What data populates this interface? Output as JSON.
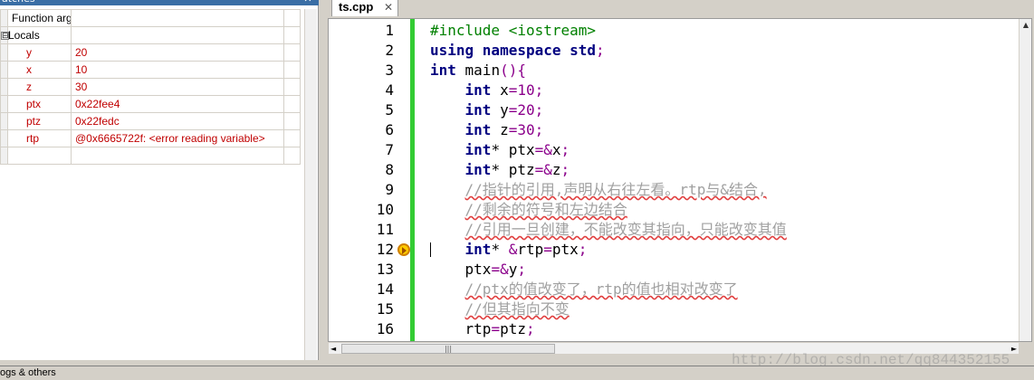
{
  "watches": {
    "title": "atches",
    "close": "✕",
    "rows": [
      {
        "name": "Function arg",
        "value": "",
        "type": "",
        "color": "#000000",
        "expander": ""
      },
      {
        "name": "Locals",
        "value": "",
        "type": "",
        "color": "#000000",
        "expander": "⊟"
      },
      {
        "name": "y",
        "value": "20",
        "type": "",
        "color": "#c00000",
        "expander": ""
      },
      {
        "name": "x",
        "value": "10",
        "type": "",
        "color": "#c00000",
        "expander": ""
      },
      {
        "name": "z",
        "value": "30",
        "type": "",
        "color": "#c00000",
        "expander": ""
      },
      {
        "name": "ptx",
        "value": "0x22fee4",
        "type": "",
        "color": "#c00000",
        "expander": ""
      },
      {
        "name": "ptz",
        "value": "0x22fedc",
        "type": "",
        "color": "#c00000",
        "expander": ""
      },
      {
        "name": "rtp",
        "value": "@0x6665722f: <error reading variable>",
        "type": "",
        "color": "#c00000",
        "expander": ""
      },
      {
        "name": "",
        "value": "",
        "type": "",
        "color": "#000000",
        "expander": ""
      }
    ]
  },
  "editor": {
    "tab_label": "ts.cpp",
    "tab_close": "✕",
    "breakpoint_line": 12,
    "lines": [
      {
        "num": "1",
        "tokens": [
          {
            "t": "#include <iostream>",
            "c": "pp"
          }
        ]
      },
      {
        "num": "2",
        "tokens": [
          {
            "t": "using namespace std",
            "c": "kw"
          },
          {
            "t": ";",
            "c": "op"
          }
        ]
      },
      {
        "num": "3",
        "tokens": [
          {
            "t": "int",
            "c": "kw"
          },
          {
            "t": " main",
            "c": "id"
          },
          {
            "t": "(){",
            "c": "op"
          }
        ]
      },
      {
        "num": "4",
        "tokens": [
          {
            "t": "    ",
            "c": "id"
          },
          {
            "t": "int",
            "c": "kw"
          },
          {
            "t": " x",
            "c": "id"
          },
          {
            "t": "=",
            "c": "op"
          },
          {
            "t": "10",
            "c": "nm"
          },
          {
            "t": ";",
            "c": "op"
          }
        ]
      },
      {
        "num": "5",
        "tokens": [
          {
            "t": "    ",
            "c": "id"
          },
          {
            "t": "int",
            "c": "kw"
          },
          {
            "t": " y",
            "c": "id"
          },
          {
            "t": "=",
            "c": "op"
          },
          {
            "t": "20",
            "c": "nm"
          },
          {
            "t": ";",
            "c": "op"
          }
        ]
      },
      {
        "num": "6",
        "tokens": [
          {
            "t": "    ",
            "c": "id"
          },
          {
            "t": "int",
            "c": "kw"
          },
          {
            "t": " z",
            "c": "id"
          },
          {
            "t": "=",
            "c": "op"
          },
          {
            "t": "30",
            "c": "nm"
          },
          {
            "t": ";",
            "c": "op"
          }
        ]
      },
      {
        "num": "7",
        "tokens": [
          {
            "t": "    ",
            "c": "id"
          },
          {
            "t": "int",
            "c": "kw"
          },
          {
            "t": "* ptx",
            "c": "id"
          },
          {
            "t": "=&",
            "c": "op"
          },
          {
            "t": "x",
            "c": "id"
          },
          {
            "t": ";",
            "c": "op"
          }
        ]
      },
      {
        "num": "8",
        "tokens": [
          {
            "t": "    ",
            "c": "id"
          },
          {
            "t": "int",
            "c": "kw"
          },
          {
            "t": "* ptz",
            "c": "id"
          },
          {
            "t": "=&",
            "c": "op"
          },
          {
            "t": "z",
            "c": "id"
          },
          {
            "t": ";",
            "c": "op"
          }
        ]
      },
      {
        "num": "9",
        "tokens": [
          {
            "t": "    ",
            "c": "id"
          },
          {
            "t": "//指针的引用,声明从右往左看。rtp与&结合,",
            "c": "cm"
          }
        ]
      },
      {
        "num": "10",
        "tokens": [
          {
            "t": "    ",
            "c": "id"
          },
          {
            "t": "//剩余的符号和左边结合",
            "c": "cm"
          }
        ]
      },
      {
        "num": "11",
        "tokens": [
          {
            "t": "    ",
            "c": "id"
          },
          {
            "t": "//引用一旦创建，不能改变其指向，只能改变其值",
            "c": "cm"
          }
        ]
      },
      {
        "num": "12",
        "tokens": [
          {
            "t": "    ",
            "c": "id"
          },
          {
            "t": "int",
            "c": "kw"
          },
          {
            "t": "* ",
            "c": "id"
          },
          {
            "t": "&",
            "c": "op"
          },
          {
            "t": "rtp",
            "c": "id"
          },
          {
            "t": "=",
            "c": "op"
          },
          {
            "t": "ptx",
            "c": "id"
          },
          {
            "t": ";",
            "c": "op"
          }
        ]
      },
      {
        "num": "13",
        "tokens": [
          {
            "t": "    ",
            "c": "id"
          },
          {
            "t": "ptx",
            "c": "id"
          },
          {
            "t": "=&",
            "c": "op"
          },
          {
            "t": "y",
            "c": "id"
          },
          {
            "t": ";",
            "c": "op"
          }
        ]
      },
      {
        "num": "14",
        "tokens": [
          {
            "t": "    ",
            "c": "id"
          },
          {
            "t": "//ptx的值改变了，rtp的值也相对改变了",
            "c": "cm"
          }
        ]
      },
      {
        "num": "15",
        "tokens": [
          {
            "t": "    ",
            "c": "id"
          },
          {
            "t": "//但其指向不变",
            "c": "cm"
          }
        ]
      },
      {
        "num": "16",
        "tokens": [
          {
            "t": "    ",
            "c": "id"
          },
          {
            "t": "rtp",
            "c": "id"
          },
          {
            "t": "=",
            "c": "op"
          },
          {
            "t": "ptz",
            "c": "id"
          },
          {
            "t": ";",
            "c": "op"
          }
        ]
      }
    ]
  },
  "scroll": {
    "up": "▲",
    "down": "▼",
    "left": "◄",
    "right": "►",
    "grip": "|||"
  },
  "watermark": "http://blog.csdn.net/qq844352155",
  "bottom": {
    "label": "ogs & others"
  }
}
